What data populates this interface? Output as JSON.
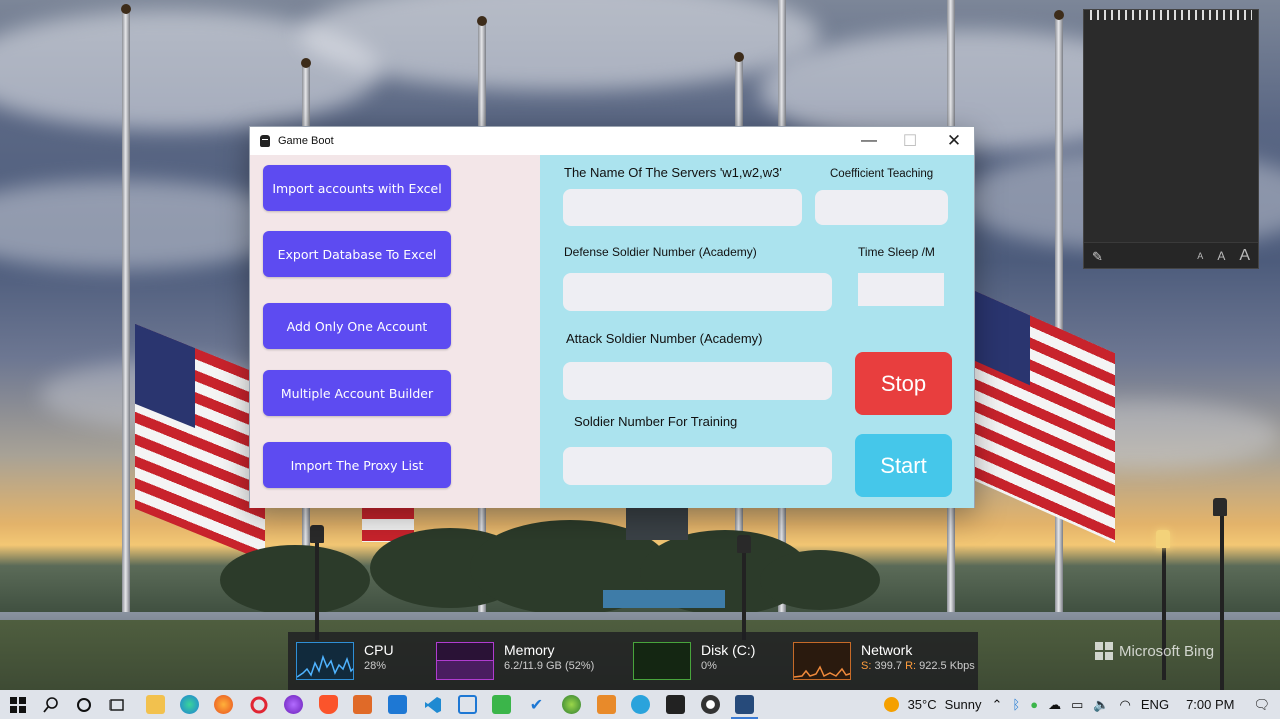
{
  "window": {
    "title": "Game Boot",
    "minimize_glyph": "—",
    "maximize_glyph": "☐",
    "close_glyph": "✕"
  },
  "left_panel": {
    "buttons": [
      {
        "label": "Import accounts with Excel"
      },
      {
        "label": "Export Database To Excel"
      },
      {
        "label": "Add Only One Account"
      },
      {
        "label": "Multiple Account Builder"
      },
      {
        "label": "Import The Proxy List"
      }
    ]
  },
  "right_panel": {
    "servers_label": "The Name Of The Servers 'w1,w2,w3'",
    "servers_value": "",
    "coefficient_label": "Coefficient Teaching",
    "coefficient_value": "",
    "defense_label": "Defense Soldier Number (Academy)",
    "defense_value": "",
    "time_sleep_label": "Time Sleep /M",
    "time_sleep_value": "",
    "attack_label": "Attack Soldier Number (Academy)",
    "attack_value": "",
    "training_label": "Soldier Number For Training",
    "training_value": "",
    "stop_label": "Stop",
    "start_label": "Start",
    "colors": {
      "action": "#5d4bf1",
      "stop": "#e83e3e",
      "start": "#45c7ea",
      "panel": "#abe3ee"
    }
  },
  "system_monitor": {
    "cpu": {
      "name": "CPU",
      "value": "28%"
    },
    "memory": {
      "name": "Memory",
      "value": "6.2/11.9 GB (52%)"
    },
    "disk": {
      "name": "Disk (C:)",
      "value": "0%"
    },
    "network": {
      "name": "Network",
      "send_prefix": "S:",
      "send": "399.7",
      "recv_prefix": "R:",
      "recv": "922.5 Kbps"
    }
  },
  "watermark": "Microsoft Bing",
  "taskbar": {
    "weather_temp": "35°C",
    "weather_desc": "Sunny",
    "language": "ENG",
    "time": "7:00 PM"
  }
}
